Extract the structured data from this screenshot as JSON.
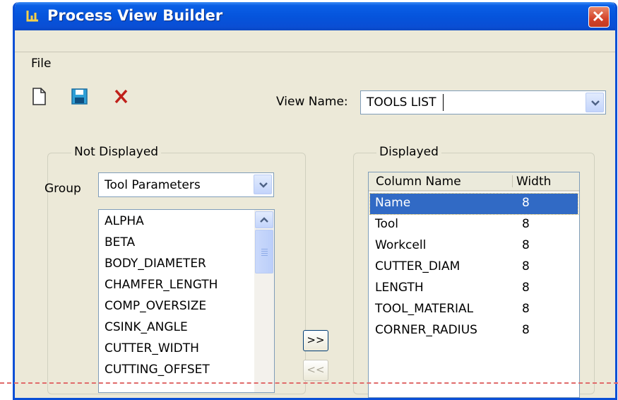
{
  "window": {
    "title": "Process View Builder"
  },
  "menu": {
    "file": "File"
  },
  "toolbar": {
    "new_icon": "new-document-icon",
    "save_icon": "floppy-disk-icon",
    "delete_icon": "red-x-icon"
  },
  "view": {
    "label": "View Name:",
    "value": "TOOLS LIST"
  },
  "not_displayed": {
    "title": "Not Displayed",
    "group_label": "Group",
    "group_value": "Tool Parameters",
    "items": [
      "ALPHA",
      "BETA",
      "BODY_DIAMETER",
      "CHAMFER_LENGTH",
      "COMP_OVERSIZE",
      "CSINK_ANGLE",
      "CUTTER_WIDTH",
      "CUTTING_OFFSET"
    ]
  },
  "buttons": {
    "add": ">>",
    "remove": "<<"
  },
  "displayed": {
    "title": "Displayed",
    "columns": [
      "Column Name",
      "Width"
    ],
    "rows": [
      {
        "name": "Name",
        "width": "8"
      },
      {
        "name": "Tool",
        "width": "8"
      },
      {
        "name": "Workcell",
        "width": "8"
      },
      {
        "name": "CUTTER_DIAM",
        "width": "8"
      },
      {
        "name": "LENGTH",
        "width": "8"
      },
      {
        "name": "TOOL_MATERIAL",
        "width": "8"
      },
      {
        "name": "CORNER_RADIUS",
        "width": "8"
      }
    ]
  },
  "colors": {
    "titlebar": "#0554dc",
    "selection": "#316ac5",
    "face": "#ece9d8"
  }
}
